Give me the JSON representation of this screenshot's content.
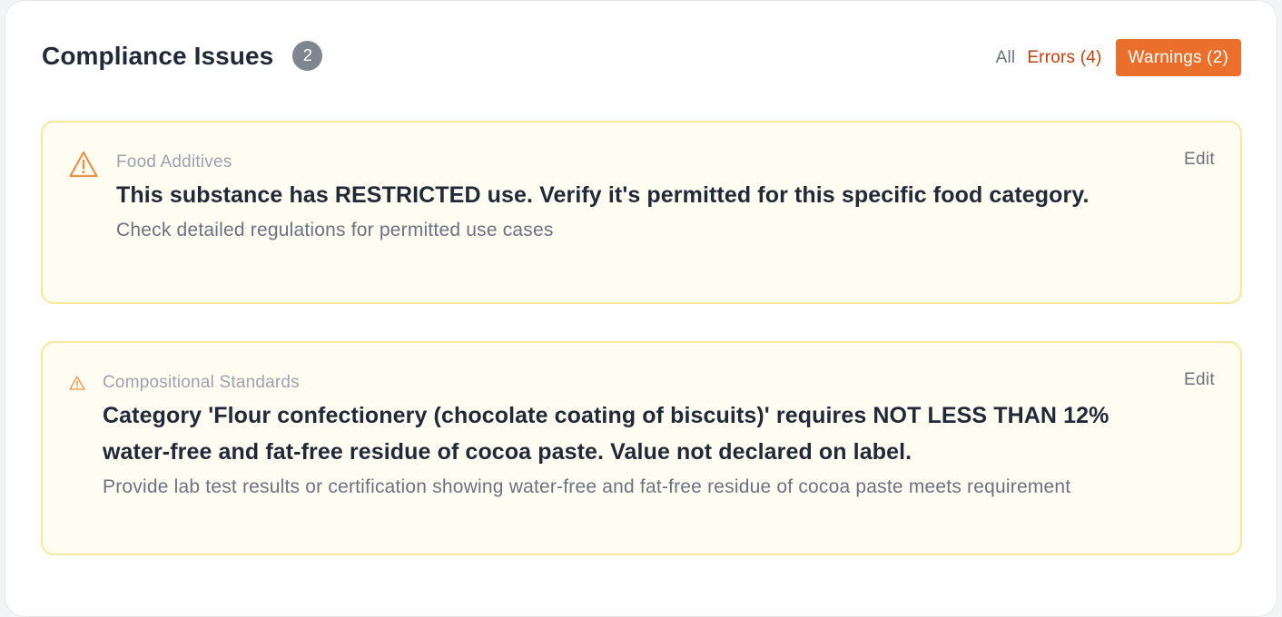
{
  "header": {
    "title": "Compliance Issues",
    "count": "2"
  },
  "filters": {
    "all": "All",
    "errors": "Errors (4)",
    "warnings": "Warnings (2)"
  },
  "colors": {
    "warning_accent": "#ea6f2b",
    "error_text": "#c2410c",
    "card_background": "#fffcf2",
    "card_border": "#f8e79c"
  },
  "issues": [
    {
      "category": "Food Additives",
      "message": "This substance has RESTRICTED use. Verify it's permitted for this specific food category.",
      "hint": "Check detailed regulations for permitted use cases",
      "action": "Edit",
      "icon": "warning-triangle-icon"
    },
    {
      "category": "Compositional Standards",
      "message": "Category 'Flour confectionery (chocolate coating of biscuits)' requires NOT LESS THAN 12% water-free and fat-free residue of cocoa paste. Value not declared on label.",
      "hint": "Provide lab test results or certification showing water-free and fat-free residue of cocoa paste meets requirement",
      "action": "Edit",
      "icon": "warning-triangle-icon"
    }
  ]
}
